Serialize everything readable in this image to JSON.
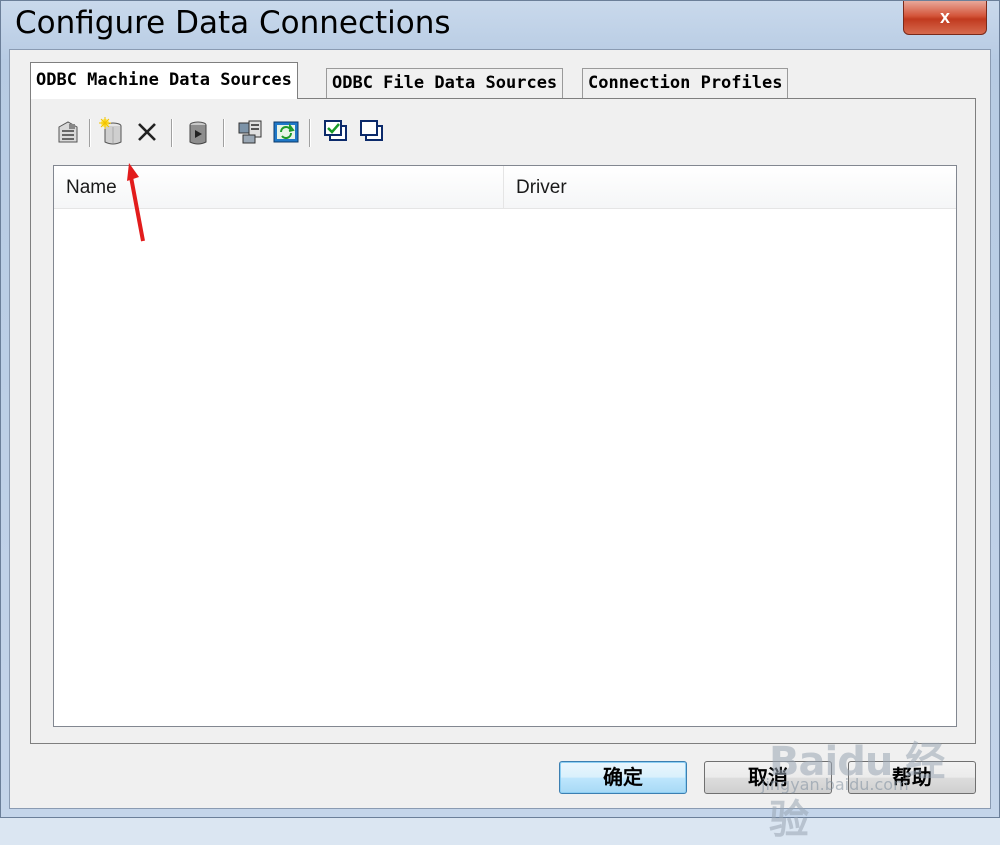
{
  "window": {
    "title": "Configure Data Connections",
    "close_label": "x"
  },
  "tabs": [
    {
      "label": "ODBC Machine Data Sources",
      "active": true
    },
    {
      "label": "ODBC File Data Sources",
      "active": false
    },
    {
      "label": "Connection Profiles",
      "active": false
    }
  ],
  "toolbar": {
    "icons": [
      "properties-icon",
      "new-data-source-icon",
      "delete-icon",
      "run-icon",
      "configure-icon",
      "refresh-icon",
      "select-all-icon",
      "copy-icon"
    ]
  },
  "list": {
    "columns": [
      "Name",
      "Driver"
    ],
    "rows": []
  },
  "buttons": {
    "ok": "确定",
    "cancel": "取消",
    "help": "帮助"
  },
  "watermark": {
    "text": "Baidu 经验",
    "url_text": "jingyan.baidu.com"
  },
  "colors": {
    "close_button": "#c13a1f",
    "arrow": "#e21c1c",
    "ok_button_border": "#3c7fb1"
  }
}
